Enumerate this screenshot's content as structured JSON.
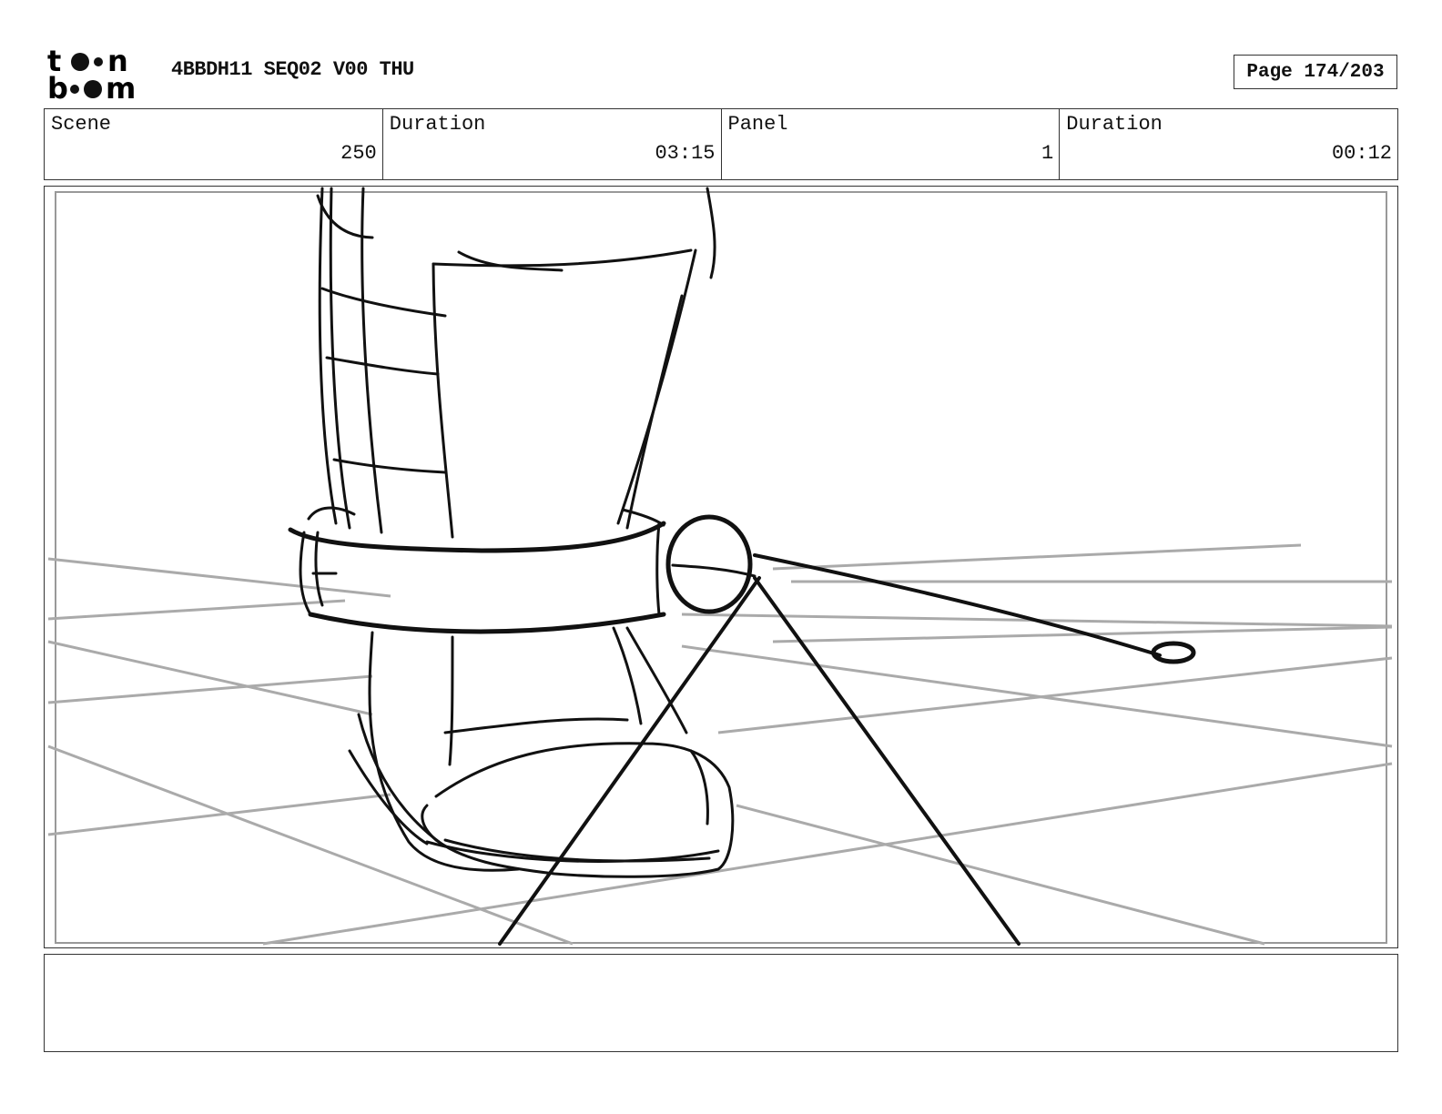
{
  "header": {
    "logo_top": "to●n",
    "logo_bottom": "b●●m",
    "title": "4BBDH11 SEQ02 V00 THU",
    "page": "Page 174/203"
  },
  "info": {
    "scene_label": "Scene",
    "scene_value": "250",
    "duration_label": "Duration",
    "duration_value": "03:15",
    "panel_label": "Panel",
    "panel_value": "1",
    "panel_duration_label": "Duration",
    "panel_duration_value": "00:12"
  },
  "notes": {
    "text": ""
  }
}
